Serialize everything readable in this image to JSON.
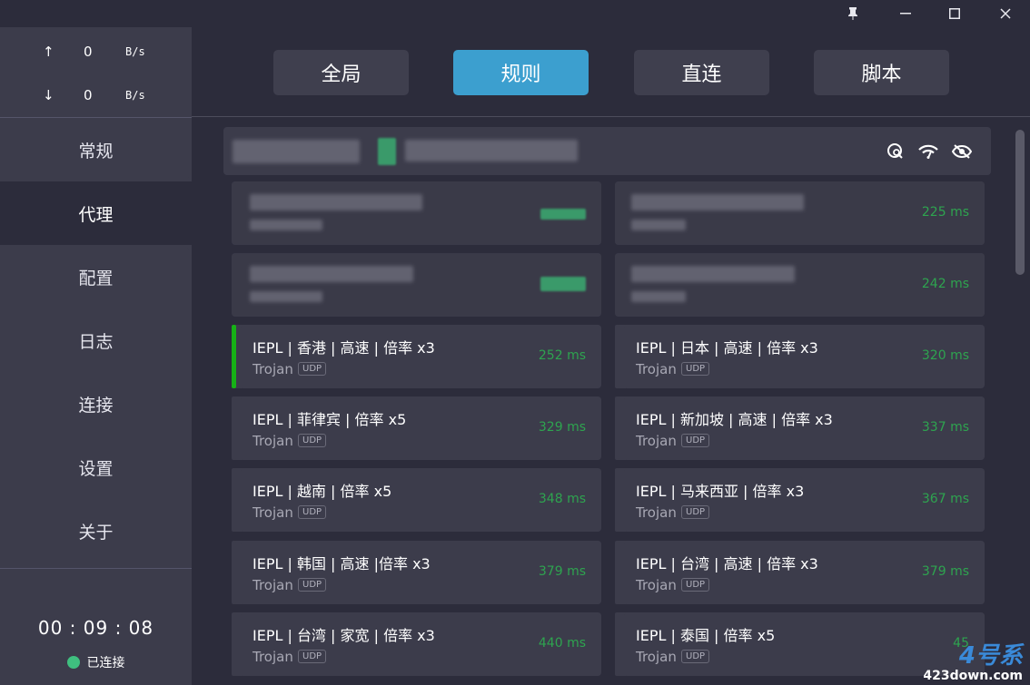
{
  "window": {
    "pin_icon": "pin-icon",
    "minimize": "—",
    "maximize": "☐",
    "close": "✕"
  },
  "traffic": {
    "upload": {
      "arrow": "↑",
      "value": "0",
      "unit": "B/s"
    },
    "download": {
      "arrow": "↓",
      "value": "0",
      "unit": "B/s"
    }
  },
  "nav": {
    "items": [
      {
        "label": "常规"
      },
      {
        "label": "代理"
      },
      {
        "label": "配置"
      },
      {
        "label": "日志"
      },
      {
        "label": "连接"
      },
      {
        "label": "设置"
      },
      {
        "label": "关于"
      }
    ],
    "active": "代理"
  },
  "status": {
    "timer": "00 : 09 : 08",
    "label": "已连接",
    "dot_color": "#3fbf7f"
  },
  "modes": [
    {
      "label": "全局"
    },
    {
      "label": "规则"
    },
    {
      "label": "直连"
    },
    {
      "label": "脚本"
    }
  ],
  "active_mode": "规则",
  "group_header": {
    "icons": [
      "search-latency-icon",
      "wifi-speed-icon",
      "eye-hide-icon"
    ]
  },
  "proxies": [
    {
      "name": "",
      "protocol": "",
      "delay": "",
      "blurred": true
    },
    {
      "name": "",
      "protocol": "",
      "delay": "225 ms",
      "blurred": true
    },
    {
      "name": "",
      "protocol": "",
      "delay": "",
      "blurred": true
    },
    {
      "name": "",
      "protocol": "",
      "delay": "242 ms",
      "blurred": true
    },
    {
      "name": "IEPL | 香港 | 高速 | 倍率 x3",
      "protocol": "Trojan",
      "udp": "UDP",
      "delay": "252 ms",
      "selected": true
    },
    {
      "name": "IEPL | 日本 | 高速 | 倍率 x3",
      "protocol": "Trojan",
      "udp": "UDP",
      "delay": "320 ms"
    },
    {
      "name": "IEPL | 菲律宾 | 倍率 x5",
      "protocol": "Trojan",
      "udp": "UDP",
      "delay": "329 ms"
    },
    {
      "name": "IEPL | 新加坡 | 高速 | 倍率 x3",
      "protocol": "Trojan",
      "udp": "UDP",
      "delay": "337 ms"
    },
    {
      "name": "IEPL | 越南 | 倍率 x5",
      "protocol": "Trojan",
      "udp": "UDP",
      "delay": "348 ms"
    },
    {
      "name": "IEPL | 马来西亚 | 倍率 x3",
      "protocol": "Trojan",
      "udp": "UDP",
      "delay": "367 ms"
    },
    {
      "name": "IEPL | 韩国 | 高速 |倍率 x3",
      "protocol": "Trojan",
      "udp": "UDP",
      "delay": "379 ms"
    },
    {
      "name": "IEPL | 台湾 | 高速 | 倍率 x3",
      "protocol": "Trojan",
      "udp": "UDP",
      "delay": "379 ms"
    },
    {
      "name": "IEPL | 台湾 | 家宽 | 倍率 x3",
      "protocol": "Trojan",
      "udp": "UDP",
      "delay": "440 ms"
    },
    {
      "name": "IEPL | 泰国 | 倍率 x5",
      "protocol": "Trojan",
      "udp": "UDP",
      "delay": "45"
    }
  ],
  "watermark": {
    "top": "4号系",
    "bottom": "423down.com"
  },
  "colors": {
    "accent": "#3c9fcf",
    "delay_green": "#2ea44f",
    "selected_bar": "#16b216",
    "panel": "#3c3c4b",
    "background": "#2c2c3b"
  }
}
